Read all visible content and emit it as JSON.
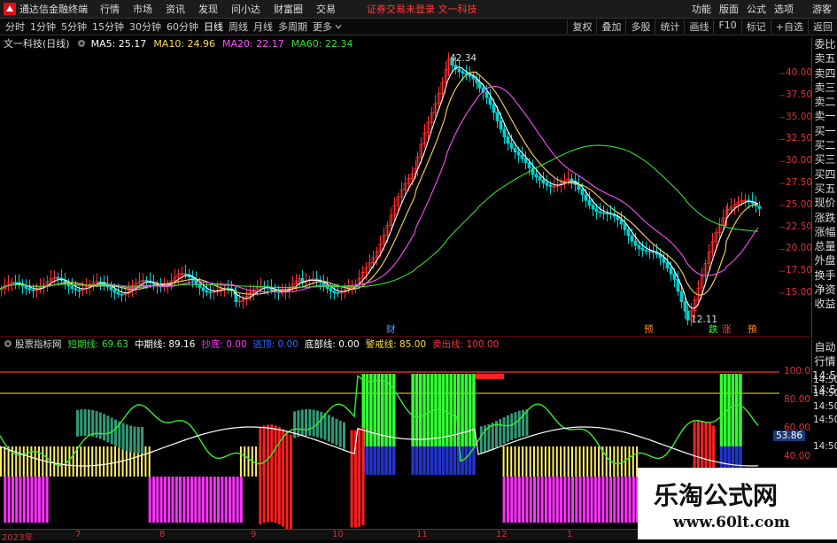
{
  "app": {
    "title": "通达信金融终端"
  },
  "menu": [
    "行情",
    "市场",
    "资讯",
    "发现",
    "问小达",
    "财富圈",
    "交易"
  ],
  "notice": "证券交易未登录  文一科技",
  "menu_right": [
    "功能",
    "版面",
    "公式",
    "选项"
  ],
  "guest": "游客",
  "periods": [
    "分时",
    "1分钟",
    "5分钟",
    "15分钟",
    "30分钟",
    "60分钟",
    "日线",
    "周线",
    "月线",
    "多周期",
    "更多"
  ],
  "active_period": "日线",
  "toolbar_right": [
    "复权",
    "叠加",
    "多股",
    "统计",
    "画线",
    "F10",
    "标记",
    "+自选",
    "返回"
  ],
  "chart_title": "文一科技(日线)",
  "ma": [
    {
      "label": "MA5: 25.17",
      "color": "#ffffff"
    },
    {
      "label": "MA10: 24.96",
      "color": "#ffd75a"
    },
    {
      "label": "MA20: 22.17",
      "color": "#ff4dff"
    },
    {
      "label": "MA60: 22.34",
      "color": "#33dd33"
    }
  ],
  "right_panel": [
    "委比",
    "卖五",
    "卖四",
    "卖三",
    "卖二",
    "卖一",
    "买一",
    "买二",
    "买三",
    "买四",
    "买五",
    "现价",
    "涨跌",
    "涨幅",
    "总量",
    "外盘",
    "换手",
    "净资",
    "收益"
  ],
  "right_panel2": [
    "自动",
    "行情",
    "14:50",
    "14:50"
  ],
  "price_axis": [
    "40.00",
    "37.50",
    "35.00",
    "32.50",
    "30.00",
    "27.50",
    "25.00",
    "22.50",
    "20.00",
    "17.50",
    "15.00"
  ],
  "high_label": "42.34",
  "low_label": "12.11",
  "markers": [
    {
      "text": "财",
      "color": "#5599ff"
    },
    {
      "text": "预",
      "color": "#ff8833"
    },
    {
      "text": "跌",
      "color": "#33ff33"
    },
    {
      "text": "涨",
      "color": "#ff4444"
    },
    {
      "text": "預",
      "color": "#ff8833"
    }
  ],
  "indicator_title": "股票指标网",
  "indicator_legend": [
    {
      "label": "短期线: 69.63",
      "color": "#33dd33"
    },
    {
      "label": "中期线: 89.16",
      "color": "#ffffff"
    },
    {
      "label": "抄底: 0.00",
      "color": "#ff33ff"
    },
    {
      "label": "逃顶: 0.00",
      "color": "#3366ff"
    },
    {
      "label": "底部线: 0.00",
      "color": "#ffffff"
    },
    {
      "label": "警戒线: 85.00",
      "color": "#ffdd33"
    },
    {
      "label": "卖出线: 100.00",
      "color": "#ff3333"
    }
  ],
  "ind_axis": [
    "100.0",
    "80.00",
    "60.00",
    "40.00"
  ],
  "ind_times": [
    "14:50",
    "14:50",
    "14:50",
    "14:50",
    "14:50"
  ],
  "ind_value": "53.86",
  "dates": [
    "2023年",
    "7",
    "8",
    "9",
    "10",
    "11",
    "12",
    "1"
  ],
  "watermark": {
    "cn": "乐淘公式网",
    "url": "www.60lt.com"
  }
}
